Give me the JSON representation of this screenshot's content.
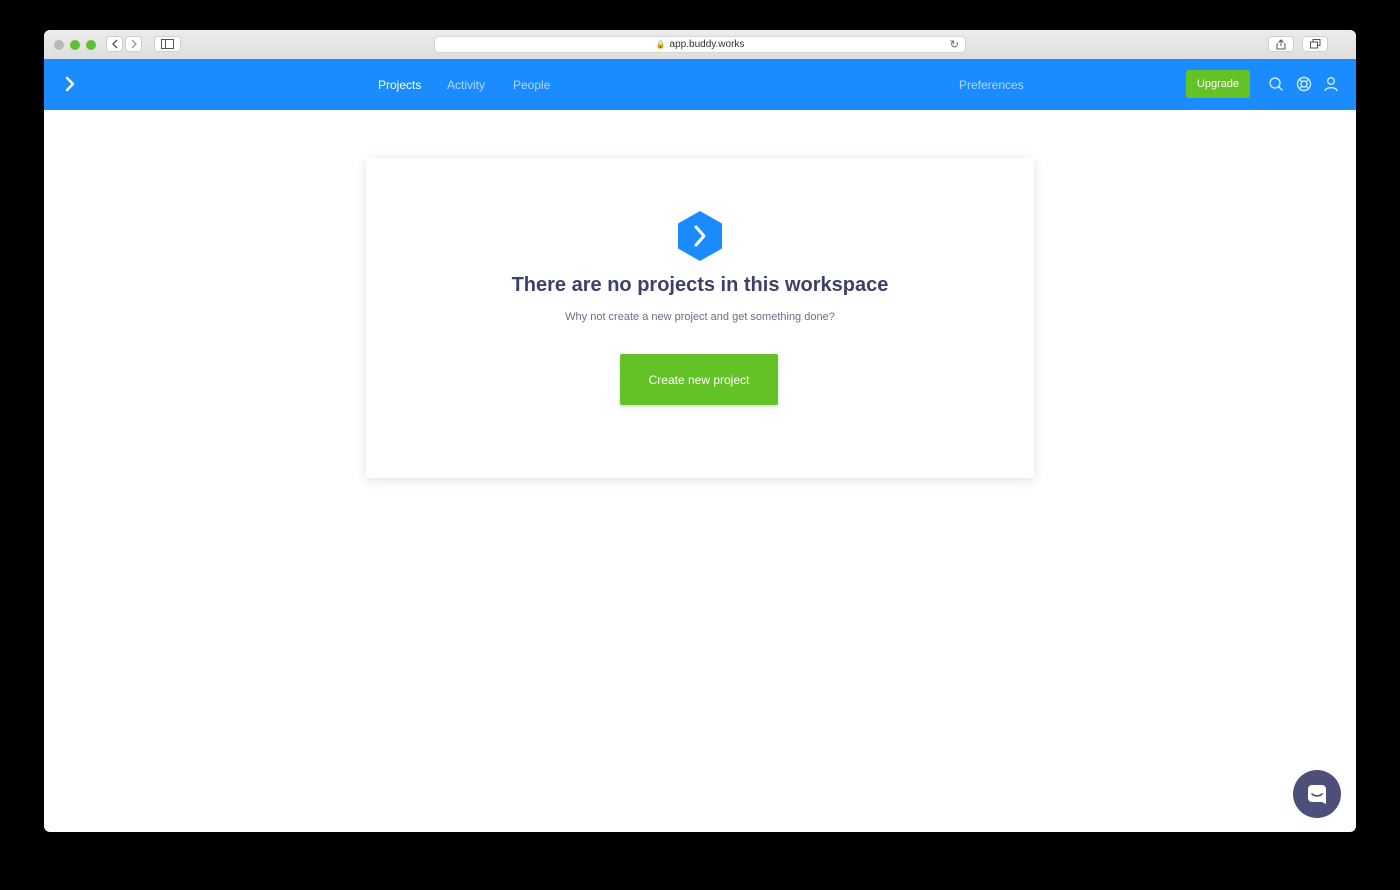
{
  "browser": {
    "url": "app.buddy.works"
  },
  "header": {
    "nav": [
      {
        "label": "Projects"
      },
      {
        "label": "Activity"
      },
      {
        "label": "People"
      }
    ],
    "preferences_label": "Preferences",
    "upgrade_label": "Upgrade"
  },
  "empty_state": {
    "title": "There are no projects in this workspace",
    "subtitle": "Why not create a new project and get something done?",
    "button_label": "Create new project"
  },
  "colors": {
    "brand_blue": "#1a8cff",
    "accent_green": "#62c226",
    "title_text": "#3d4168",
    "chat_bubble": "#4d4f7a"
  },
  "icons": {
    "logo": "chevron-right-icon",
    "search": "search-icon",
    "support": "lifebuoy-icon",
    "profile": "user-icon",
    "chat": "chat-icon"
  }
}
